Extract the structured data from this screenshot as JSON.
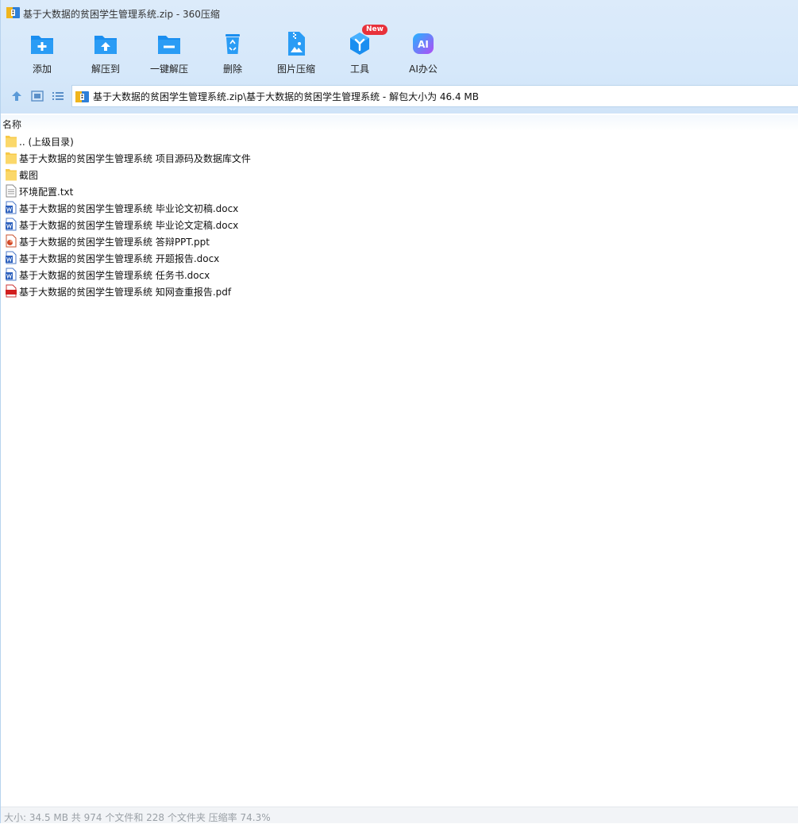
{
  "window": {
    "title": "基于大数据的贫困学生管理系统.zip - 360压缩"
  },
  "toolbar": {
    "items": [
      {
        "label": "添加"
      },
      {
        "label": "解压到"
      },
      {
        "label": "一键解压"
      },
      {
        "label": "删除"
      },
      {
        "label": "图片压缩"
      },
      {
        "label": "工具",
        "badge": "New"
      },
      {
        "label": "AI办公",
        "icon_text": "AI"
      }
    ]
  },
  "address": {
    "path": "基于大数据的贫困学生管理系统.zip\\基于大数据的贫困学生管理系统 - 解包大小为 46.4 MB"
  },
  "list": {
    "column_name": "名称",
    "rows": [
      {
        "name": ".. (上级目录)",
        "type": "folder"
      },
      {
        "name": "基于大数据的贫困学生管理系统 项目源码及数据库文件",
        "type": "folder"
      },
      {
        "name": "截图",
        "type": "folder"
      },
      {
        "name": "环境配置.txt",
        "type": "txt"
      },
      {
        "name": "基于大数据的贫困学生管理系统 毕业论文初稿.docx",
        "type": "docx"
      },
      {
        "name": "基于大数据的贫困学生管理系统 毕业论文定稿.docx",
        "type": "docx"
      },
      {
        "name": "基于大数据的贫困学生管理系统 答辩PPT.ppt",
        "type": "ppt"
      },
      {
        "name": "基于大数据的贫困学生管理系统 开题报告.docx",
        "type": "docx"
      },
      {
        "name": "基于大数据的贫困学生管理系统 任务书.docx",
        "type": "docx"
      },
      {
        "name": "基于大数据的贫困学生管理系统 知网查重报告.pdf",
        "type": "pdf"
      }
    ]
  },
  "status": {
    "text": "大小: 34.5 MB 共 974 个文件和 228 个文件夹 压缩率 74.3%"
  },
  "colors": {
    "accent": "#1a8ef0",
    "toolbar_bg": "#d6e8fa",
    "badge": "#e8313a",
    "ai_gradient": [
      "#22b4ff",
      "#b34cf5"
    ]
  }
}
